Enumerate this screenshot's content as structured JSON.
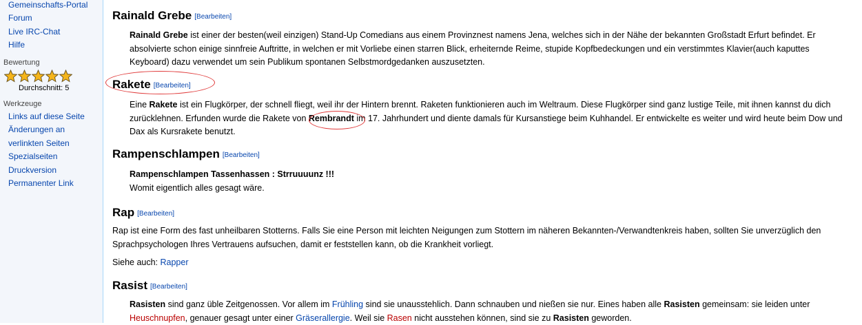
{
  "sidebar": {
    "nav_links": [
      "Gemeinschafts-Portal",
      "Forum",
      "Live IRC-Chat",
      "Hilfe"
    ],
    "rating": {
      "heading": "Bewertung",
      "stars": 5,
      "average_label": "Durchschnitt: 5"
    },
    "tools": {
      "heading": "Werkzeuge",
      "links": [
        "Links auf diese Seite",
        "Änderungen an",
        "verlinkten Seiten",
        "Spezialseiten",
        "Druckversion",
        "Permanenter Link"
      ]
    }
  },
  "sections": [
    {
      "title": "Rainald Grebe",
      "edit": "[Bearbeiten]",
      "lines": [
        {
          "b1": "Rainald Grebe",
          "t1": " ist einer der besten(weil einzigen) Stand-Up Comedians aus einem Provinznest namens Jena, welches sich in der Nähe der bekannten Großstadt Erfurt befindet. Er"
        },
        {
          "t1": "absolvierte schon einige sinnfreie Auftritte, in welchen er mit Vorliebe einen starren Blick, erheiternde Reime, stupide Kopfbedeckungen und ein verstimmtes Klavier(auch kaputtes"
        },
        {
          "t1": "Keyboard) dazu verwendet um sein Publikum spontanen Selbstmordgedanken auszusetzten."
        }
      ]
    },
    {
      "title": "Rakete",
      "edit": "[Bearbeiten]",
      "lines": [
        {
          "t1": "Eine ",
          "b1": "Rakete",
          "t2": " ist ein Flugkörper, der schnell fliegt, weil ihr der Hintern brennt. Raketen funktionieren auch im Weltraum. Diese Flugkörper sind ganz lustige Teile, mit ihnen kannst du dich"
        },
        {
          "t1": "zurücklehnen. Erfunden wurde die Rakete von ",
          "b1": "Rembrandt",
          "t2": " im 17. Jahrhundert und diente damals für Kursanstiege beim Kuhhandel. Er entwickelte es weiter und wird heute beim Dow und"
        },
        {
          "t1": "Dax als Kursrakete benutzt."
        }
      ]
    },
    {
      "title": "Rampenschlampen",
      "edit": "[Bearbeiten]",
      "lines": [
        {
          "b1": "Rampenschlampen Tassenhassen : Strruuuunz !!!"
        },
        {
          "t1": "Womit eigentlich alles gesagt wäre."
        }
      ]
    },
    {
      "title": "Rap",
      "edit": "[Bearbeiten]",
      "lines": [
        {
          "t1": "Rap ist eine Form des fast unheilbaren Stotterns. Falls Sie eine Person mit leichten Neigungen zum Stottern im näheren Bekannten-/Verwandtenkreis haben, sollten Sie unverzüglich den"
        },
        {
          "t1": "Sprachpsychologen Ihres Vertrauens aufsuchen, damit er feststellen kann, ob die Krankheit vorliegt."
        }
      ],
      "see_also": {
        "label": "Siehe auch: ",
        "link": "Rapper"
      }
    },
    {
      "title": "Rasist",
      "edit": "[Bearbeiten]",
      "lines": [
        {
          "b1": "Rasisten",
          "t1": " sind ganz üble Zeitgenossen. Vor allem im ",
          "l1": "Frühling",
          "t2": " sind sie unausstehlich. Dann schnauben und nießen sie nur. Eines haben alle ",
          "b2": "Rasisten",
          "t3": " gemeinsam: sie leiden unter"
        },
        {
          "r1": "Heuschnupfen",
          "t1": ", genauer gesagt unter einer ",
          "l1": "Gräserallergie",
          "t2": ". Weil sie ",
          "r2": "Rasen",
          "t3": " nicht ausstehen können, sind sie zu ",
          "b1": "Rasisten",
          "t4": " geworden."
        }
      ]
    }
  ],
  "colors": {
    "link": "#0645ad",
    "redlink": "#ba0000",
    "sidebar_bg": "#f3f6fb",
    "annotation": "#e03a3a"
  }
}
